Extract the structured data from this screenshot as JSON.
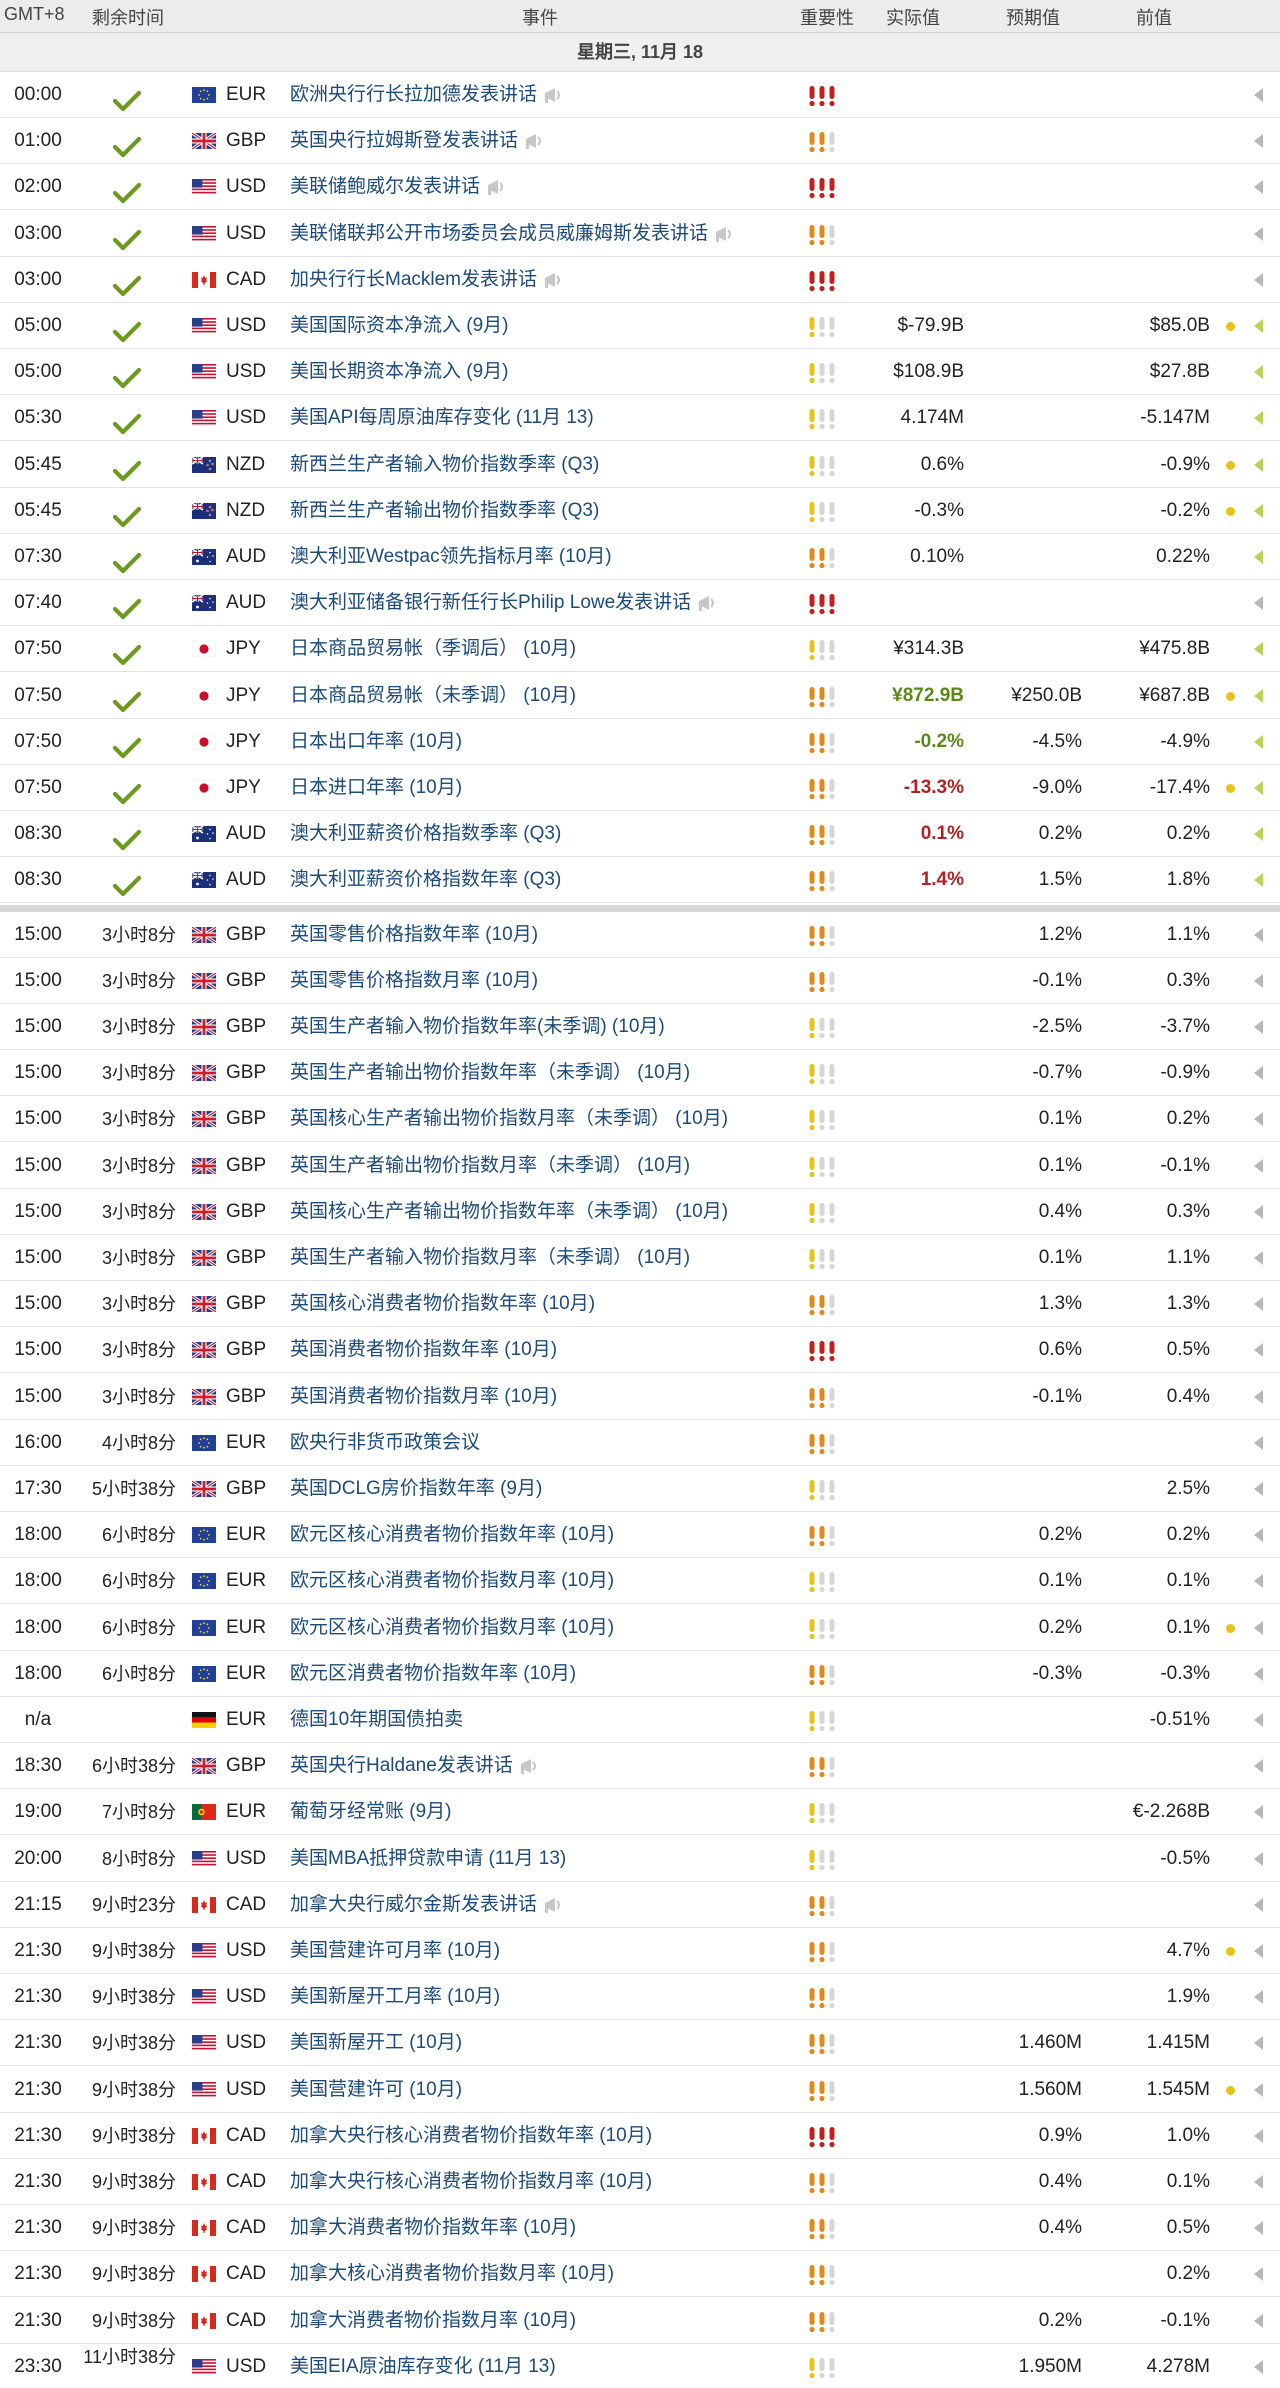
{
  "header": {
    "timezone": "GMT+8",
    "remaining": "剩余时间",
    "event": "事件",
    "importance": "重要性",
    "actual": "实际值",
    "forecast": "预期值",
    "previous": "前值"
  },
  "date_label": "星期三, 11月 18",
  "colors": {
    "impact_high": "#c0201e",
    "impact_medium": "#e08a1e",
    "impact_low": "#e6c21a",
    "impact_empty": "#d6d6d6",
    "positive": "#5a8a16",
    "negative": "#b52020"
  },
  "events": [
    {
      "time": "00:00",
      "remaining": "",
      "done": true,
      "flag": "eu",
      "currency": "EUR",
      "event": "欧洲央行行长拉加德发表讲话",
      "speech": true,
      "impact": 3,
      "actual": "",
      "actual_dir": "",
      "forecast": "",
      "previous": "",
      "dot": false,
      "arrow": "gray"
    },
    {
      "time": "01:00",
      "remaining": "",
      "done": true,
      "flag": "gb",
      "currency": "GBP",
      "event": "英国央行拉姆斯登发表讲话",
      "speech": true,
      "impact": 2,
      "actual": "",
      "actual_dir": "",
      "forecast": "",
      "previous": "",
      "dot": false,
      "arrow": "gray"
    },
    {
      "time": "02:00",
      "remaining": "",
      "done": true,
      "flag": "us",
      "currency": "USD",
      "event": "美联储鲍威尔发表讲话",
      "speech": true,
      "impact": 3,
      "actual": "",
      "actual_dir": "",
      "forecast": "",
      "previous": "",
      "dot": false,
      "arrow": "gray"
    },
    {
      "time": "03:00",
      "remaining": "",
      "done": true,
      "flag": "us",
      "currency": "USD",
      "event": "美联储联邦公开市场委员会成员威廉姆斯发表讲话",
      "speech": true,
      "impact": 2,
      "actual": "",
      "actual_dir": "",
      "forecast": "",
      "previous": "",
      "dot": false,
      "arrow": "gray"
    },
    {
      "time": "03:00",
      "remaining": "",
      "done": true,
      "flag": "ca",
      "currency": "CAD",
      "event": "加央行行长Macklem发表讲话",
      "speech": true,
      "impact": 3,
      "actual": "",
      "actual_dir": "",
      "forecast": "",
      "previous": "",
      "dot": false,
      "arrow": "gray"
    },
    {
      "time": "05:00",
      "remaining": "",
      "done": true,
      "flag": "us",
      "currency": "USD",
      "event": "美国国际资本净流入 (9月)",
      "speech": false,
      "impact": 1,
      "actual": "$-79.9B",
      "actual_dir": "",
      "forecast": "",
      "previous": "$85.0B",
      "dot": true,
      "arrow": "green"
    },
    {
      "time": "05:00",
      "remaining": "",
      "done": true,
      "flag": "us",
      "currency": "USD",
      "event": "美国长期资本净流入 (9月)",
      "speech": false,
      "impact": 1,
      "actual": "$108.9B",
      "actual_dir": "",
      "forecast": "",
      "previous": "$27.8B",
      "dot": false,
      "arrow": "green"
    },
    {
      "time": "05:30",
      "remaining": "",
      "done": true,
      "flag": "us",
      "currency": "USD",
      "event": "美国API每周原油库存变化 (11月 13)",
      "speech": false,
      "impact": 1,
      "actual": "4.174M",
      "actual_dir": "",
      "forecast": "",
      "previous": "-5.147M",
      "dot": false,
      "arrow": "green"
    },
    {
      "time": "05:45",
      "remaining": "",
      "done": true,
      "flag": "nz",
      "currency": "NZD",
      "event": "新西兰生产者输入物价指数季率 (Q3)",
      "speech": false,
      "impact": 1,
      "actual": "0.6%",
      "actual_dir": "",
      "forecast": "",
      "previous": "-0.9%",
      "dot": true,
      "arrow": "green"
    },
    {
      "time": "05:45",
      "remaining": "",
      "done": true,
      "flag": "nz",
      "currency": "NZD",
      "event": "新西兰生产者输出物价指数季率 (Q3)",
      "speech": false,
      "impact": 1,
      "actual": "-0.3%",
      "actual_dir": "",
      "forecast": "",
      "previous": "-0.2%",
      "dot": true,
      "arrow": "green"
    },
    {
      "time": "07:30",
      "remaining": "",
      "done": true,
      "flag": "au",
      "currency": "AUD",
      "event": "澳大利亚Westpac领先指标月率 (10月)",
      "speech": false,
      "impact": 2,
      "actual": "0.10%",
      "actual_dir": "",
      "forecast": "",
      "previous": "0.22%",
      "dot": false,
      "arrow": "green"
    },
    {
      "time": "07:40",
      "remaining": "",
      "done": true,
      "flag": "au",
      "currency": "AUD",
      "event": "澳大利亚储备银行新任行长Philip Lowe发表讲话",
      "speech": true,
      "impact": 3,
      "actual": "",
      "actual_dir": "",
      "forecast": "",
      "previous": "",
      "dot": false,
      "arrow": "gray"
    },
    {
      "time": "07:50",
      "remaining": "",
      "done": true,
      "flag": "jp",
      "currency": "JPY",
      "event": "日本商品贸易帐（季调后） (10月)",
      "speech": false,
      "impact": 1,
      "actual": "¥314.3B",
      "actual_dir": "",
      "forecast": "",
      "previous": "¥475.8B",
      "dot": false,
      "arrow": "green"
    },
    {
      "time": "07:50",
      "remaining": "",
      "done": true,
      "flag": "jp",
      "currency": "JPY",
      "event": "日本商品贸易帐（未季调） (10月)",
      "speech": false,
      "impact": 2,
      "actual": "¥872.9B",
      "actual_dir": "pos",
      "forecast": "¥250.0B",
      "previous": "¥687.8B",
      "dot": true,
      "arrow": "green"
    },
    {
      "time": "07:50",
      "remaining": "",
      "done": true,
      "flag": "jp",
      "currency": "JPY",
      "event": "日本出口年率 (10月)",
      "speech": false,
      "impact": 2,
      "actual": "-0.2%",
      "actual_dir": "pos",
      "forecast": "-4.5%",
      "previous": "-4.9%",
      "dot": false,
      "arrow": "green"
    },
    {
      "time": "07:50",
      "remaining": "",
      "done": true,
      "flag": "jp",
      "currency": "JPY",
      "event": "日本进口年率 (10月)",
      "speech": false,
      "impact": 2,
      "actual": "-13.3%",
      "actual_dir": "neg",
      "forecast": "-9.0%",
      "previous": "-17.4%",
      "dot": true,
      "arrow": "green"
    },
    {
      "time": "08:30",
      "remaining": "",
      "done": true,
      "flag": "au",
      "currency": "AUD",
      "event": "澳大利亚薪资价格指数季率 (Q3)",
      "speech": false,
      "impact": 2,
      "actual": "0.1%",
      "actual_dir": "neg",
      "forecast": "0.2%",
      "previous": "0.2%",
      "dot": false,
      "arrow": "green"
    },
    {
      "time": "08:30",
      "remaining": "",
      "done": true,
      "flag": "au",
      "currency": "AUD",
      "event": "澳大利亚薪资价格指数年率 (Q3)",
      "speech": false,
      "impact": 2,
      "actual": "1.4%",
      "actual_dir": "neg",
      "forecast": "1.5%",
      "previous": "1.8%",
      "dot": false,
      "arrow": "green"
    },
    {
      "time": "15:00",
      "remaining": "3小时8分",
      "done": false,
      "flag": "gb",
      "currency": "GBP",
      "event": "英国零售价格指数年率 (10月)",
      "speech": false,
      "impact": 2,
      "actual": "",
      "actual_dir": "",
      "forecast": "1.2%",
      "previous": "1.1%",
      "dot": false,
      "arrow": "gray"
    },
    {
      "time": "15:00",
      "remaining": "3小时8分",
      "done": false,
      "flag": "gb",
      "currency": "GBP",
      "event": "英国零售价格指数月率 (10月)",
      "speech": false,
      "impact": 2,
      "actual": "",
      "actual_dir": "",
      "forecast": "-0.1%",
      "previous": "0.3%",
      "dot": false,
      "arrow": "gray"
    },
    {
      "time": "15:00",
      "remaining": "3小时8分",
      "done": false,
      "flag": "gb",
      "currency": "GBP",
      "event": "英国生产者输入物价指数年率(未季调) (10月)",
      "speech": false,
      "impact": 1,
      "actual": "",
      "actual_dir": "",
      "forecast": "-2.5%",
      "previous": "-3.7%",
      "dot": false,
      "arrow": "gray"
    },
    {
      "time": "15:00",
      "remaining": "3小时8分",
      "done": false,
      "flag": "gb",
      "currency": "GBP",
      "event": "英国生产者输出物价指数年率（未季调） (10月)",
      "speech": false,
      "impact": 1,
      "actual": "",
      "actual_dir": "",
      "forecast": "-0.7%",
      "previous": "-0.9%",
      "dot": false,
      "arrow": "gray"
    },
    {
      "time": "15:00",
      "remaining": "3小时8分",
      "done": false,
      "flag": "gb",
      "currency": "GBP",
      "event": "英国核心生产者输出物价指数月率（未季调） (10月)",
      "speech": false,
      "impact": 1,
      "actual": "",
      "actual_dir": "",
      "forecast": "0.1%",
      "previous": "0.2%",
      "dot": false,
      "arrow": "gray"
    },
    {
      "time": "15:00",
      "remaining": "3小时8分",
      "done": false,
      "flag": "gb",
      "currency": "GBP",
      "event": "英国生产者输出物价指数月率（未季调） (10月)",
      "speech": false,
      "impact": 1,
      "actual": "",
      "actual_dir": "",
      "forecast": "0.1%",
      "previous": "-0.1%",
      "dot": false,
      "arrow": "gray"
    },
    {
      "time": "15:00",
      "remaining": "3小时8分",
      "done": false,
      "flag": "gb",
      "currency": "GBP",
      "event": "英国核心生产者输出物价指数年率（未季调） (10月)",
      "speech": false,
      "impact": 1,
      "actual": "",
      "actual_dir": "",
      "forecast": "0.4%",
      "previous": "0.3%",
      "dot": false,
      "arrow": "gray"
    },
    {
      "time": "15:00",
      "remaining": "3小时8分",
      "done": false,
      "flag": "gb",
      "currency": "GBP",
      "event": "英国生产者输入物价指数月率（未季调） (10月)",
      "speech": false,
      "impact": 1,
      "actual": "",
      "actual_dir": "",
      "forecast": "0.1%",
      "previous": "1.1%",
      "dot": false,
      "arrow": "gray"
    },
    {
      "time": "15:00",
      "remaining": "3小时8分",
      "done": false,
      "flag": "gb",
      "currency": "GBP",
      "event": "英国核心消费者物价指数年率 (10月)",
      "speech": false,
      "impact": 2,
      "actual": "",
      "actual_dir": "",
      "forecast": "1.3%",
      "previous": "1.3%",
      "dot": false,
      "arrow": "gray"
    },
    {
      "time": "15:00",
      "remaining": "3小时8分",
      "done": false,
      "flag": "gb",
      "currency": "GBP",
      "event": "英国消费者物价指数年率 (10月)",
      "speech": false,
      "impact": 3,
      "actual": "",
      "actual_dir": "",
      "forecast": "0.6%",
      "previous": "0.5%",
      "dot": false,
      "arrow": "gray"
    },
    {
      "time": "15:00",
      "remaining": "3小时8分",
      "done": false,
      "flag": "gb",
      "currency": "GBP",
      "event": "英国消费者物价指数月率 (10月)",
      "speech": false,
      "impact": 2,
      "actual": "",
      "actual_dir": "",
      "forecast": "-0.1%",
      "previous": "0.4%",
      "dot": false,
      "arrow": "gray"
    },
    {
      "time": "16:00",
      "remaining": "4小时8分",
      "done": false,
      "flag": "eu",
      "currency": "EUR",
      "event": "欧央行非货币政策会议",
      "speech": false,
      "impact": 2,
      "actual": "",
      "actual_dir": "",
      "forecast": "",
      "previous": "",
      "dot": false,
      "arrow": "gray"
    },
    {
      "time": "17:30",
      "remaining": "5小时38分",
      "done": false,
      "flag": "gb",
      "currency": "GBP",
      "event": "英国DCLG房价指数年率 (9月)",
      "speech": false,
      "impact": 1,
      "actual": "",
      "actual_dir": "",
      "forecast": "",
      "previous": "2.5%",
      "dot": false,
      "arrow": "gray"
    },
    {
      "time": "18:00",
      "remaining": "6小时8分",
      "done": false,
      "flag": "eu",
      "currency": "EUR",
      "event": "欧元区核心消费者物价指数年率 (10月)",
      "speech": false,
      "impact": 2,
      "actual": "",
      "actual_dir": "",
      "forecast": "0.2%",
      "previous": "0.2%",
      "dot": false,
      "arrow": "gray"
    },
    {
      "time": "18:00",
      "remaining": "6小时8分",
      "done": false,
      "flag": "eu",
      "currency": "EUR",
      "event": "欧元区核心消费者物价指数月率 (10月)",
      "speech": false,
      "impact": 1,
      "actual": "",
      "actual_dir": "",
      "forecast": "0.1%",
      "previous": "0.1%",
      "dot": false,
      "arrow": "gray"
    },
    {
      "time": "18:00",
      "remaining": "6小时8分",
      "done": false,
      "flag": "eu",
      "currency": "EUR",
      "event": "欧元区核心消费者物价指数月率 (10月)",
      "speech": false,
      "impact": 1,
      "actual": "",
      "actual_dir": "",
      "forecast": "0.2%",
      "previous": "0.1%",
      "dot": true,
      "arrow": "gray"
    },
    {
      "time": "18:00",
      "remaining": "6小时8分",
      "done": false,
      "flag": "eu",
      "currency": "EUR",
      "event": "欧元区消费者物价指数年率 (10月)",
      "speech": false,
      "impact": 2,
      "actual": "",
      "actual_dir": "",
      "forecast": "-0.3%",
      "previous": "-0.3%",
      "dot": false,
      "arrow": "gray"
    },
    {
      "time": "n/a",
      "remaining": "",
      "done": false,
      "flag": "de",
      "currency": "EUR",
      "event": "德国10年期国债拍卖",
      "speech": false,
      "impact": 1,
      "actual": "",
      "actual_dir": "",
      "forecast": "",
      "previous": "-0.51%",
      "dot": false,
      "arrow": "gray"
    },
    {
      "time": "18:30",
      "remaining": "6小时38分",
      "done": false,
      "flag": "gb",
      "currency": "GBP",
      "event": "英国央行Haldane发表讲话",
      "speech": true,
      "impact": 2,
      "actual": "",
      "actual_dir": "",
      "forecast": "",
      "previous": "",
      "dot": false,
      "arrow": "gray"
    },
    {
      "time": "19:00",
      "remaining": "7小时8分",
      "done": false,
      "flag": "pt",
      "currency": "EUR",
      "event": "葡萄牙经常账 (9月)",
      "speech": false,
      "impact": 1,
      "actual": "",
      "actual_dir": "",
      "forecast": "",
      "previous": "€-2.268B",
      "dot": false,
      "arrow": "gray"
    },
    {
      "time": "20:00",
      "remaining": "8小时8分",
      "done": false,
      "flag": "us",
      "currency": "USD",
      "event": "美国MBA抵押贷款申请 (11月 13)",
      "speech": false,
      "impact": 1,
      "actual": "",
      "actual_dir": "",
      "forecast": "",
      "previous": "-0.5%",
      "dot": false,
      "arrow": "gray"
    },
    {
      "time": "21:15",
      "remaining": "9小时23分",
      "done": false,
      "flag": "ca",
      "currency": "CAD",
      "event": "加拿大央行威尔金斯发表讲话",
      "speech": true,
      "impact": 2,
      "actual": "",
      "actual_dir": "",
      "forecast": "",
      "previous": "",
      "dot": false,
      "arrow": "gray"
    },
    {
      "time": "21:30",
      "remaining": "9小时38分",
      "done": false,
      "flag": "us",
      "currency": "USD",
      "event": "美国营建许可月率 (10月)",
      "speech": false,
      "impact": 2,
      "actual": "",
      "actual_dir": "",
      "forecast": "",
      "previous": "4.7%",
      "dot": true,
      "arrow": "gray"
    },
    {
      "time": "21:30",
      "remaining": "9小时38分",
      "done": false,
      "flag": "us",
      "currency": "USD",
      "event": "美国新屋开工月率 (10月)",
      "speech": false,
      "impact": 2,
      "actual": "",
      "actual_dir": "",
      "forecast": "",
      "previous": "1.9%",
      "dot": false,
      "arrow": "gray"
    },
    {
      "time": "21:30",
      "remaining": "9小时38分",
      "done": false,
      "flag": "us",
      "currency": "USD",
      "event": "美国新屋开工 (10月)",
      "speech": false,
      "impact": 2,
      "actual": "",
      "actual_dir": "",
      "forecast": "1.460M",
      "previous": "1.415M",
      "dot": false,
      "arrow": "gray"
    },
    {
      "time": "21:30",
      "remaining": "9小时38分",
      "done": false,
      "flag": "us",
      "currency": "USD",
      "event": "美国营建许可 (10月)",
      "speech": false,
      "impact": 2,
      "actual": "",
      "actual_dir": "",
      "forecast": "1.560M",
      "previous": "1.545M",
      "dot": true,
      "arrow": "gray"
    },
    {
      "time": "21:30",
      "remaining": "9小时38分",
      "done": false,
      "flag": "ca",
      "currency": "CAD",
      "event": "加拿大央行核心消费者物价指数年率 (10月)",
      "speech": false,
      "impact": 3,
      "actual": "",
      "actual_dir": "",
      "forecast": "0.9%",
      "previous": "1.0%",
      "dot": false,
      "arrow": "gray"
    },
    {
      "time": "21:30",
      "remaining": "9小时38分",
      "done": false,
      "flag": "ca",
      "currency": "CAD",
      "event": "加拿大央行核心消费者物价指数月率 (10月)",
      "speech": false,
      "impact": 2,
      "actual": "",
      "actual_dir": "",
      "forecast": "0.4%",
      "previous": "0.1%",
      "dot": false,
      "arrow": "gray"
    },
    {
      "time": "21:30",
      "remaining": "9小时38分",
      "done": false,
      "flag": "ca",
      "currency": "CAD",
      "event": "加拿大消费者物价指数年率 (10月)",
      "speech": false,
      "impact": 2,
      "actual": "",
      "actual_dir": "",
      "forecast": "0.4%",
      "previous": "0.5%",
      "dot": false,
      "arrow": "gray"
    },
    {
      "time": "21:30",
      "remaining": "9小时38分",
      "done": false,
      "flag": "ca",
      "currency": "CAD",
      "event": "加拿大核心消费者物价指数月率 (10月)",
      "speech": false,
      "impact": 2,
      "actual": "",
      "actual_dir": "",
      "forecast": "",
      "previous": "0.2%",
      "dot": false,
      "arrow": "gray"
    },
    {
      "time": "21:30",
      "remaining": "9小时38分",
      "done": false,
      "flag": "ca",
      "currency": "CAD",
      "event": "加拿大消费者物价指数月率 (10月)",
      "speech": false,
      "impact": 2,
      "actual": "",
      "actual_dir": "",
      "forecast": "0.2%",
      "previous": "-0.1%",
      "dot": false,
      "arrow": "gray"
    },
    {
      "time": "23:30",
      "remaining": "11小时38分",
      "done": false,
      "flag": "us",
      "currency": "USD",
      "event": "美国EIA原油库存变化 (11月 13)",
      "speech": false,
      "impact": 1,
      "actual": "",
      "actual_dir": "",
      "forecast": "1.950M",
      "previous": "4.278M",
      "dot": false,
      "arrow": "gray"
    }
  ]
}
